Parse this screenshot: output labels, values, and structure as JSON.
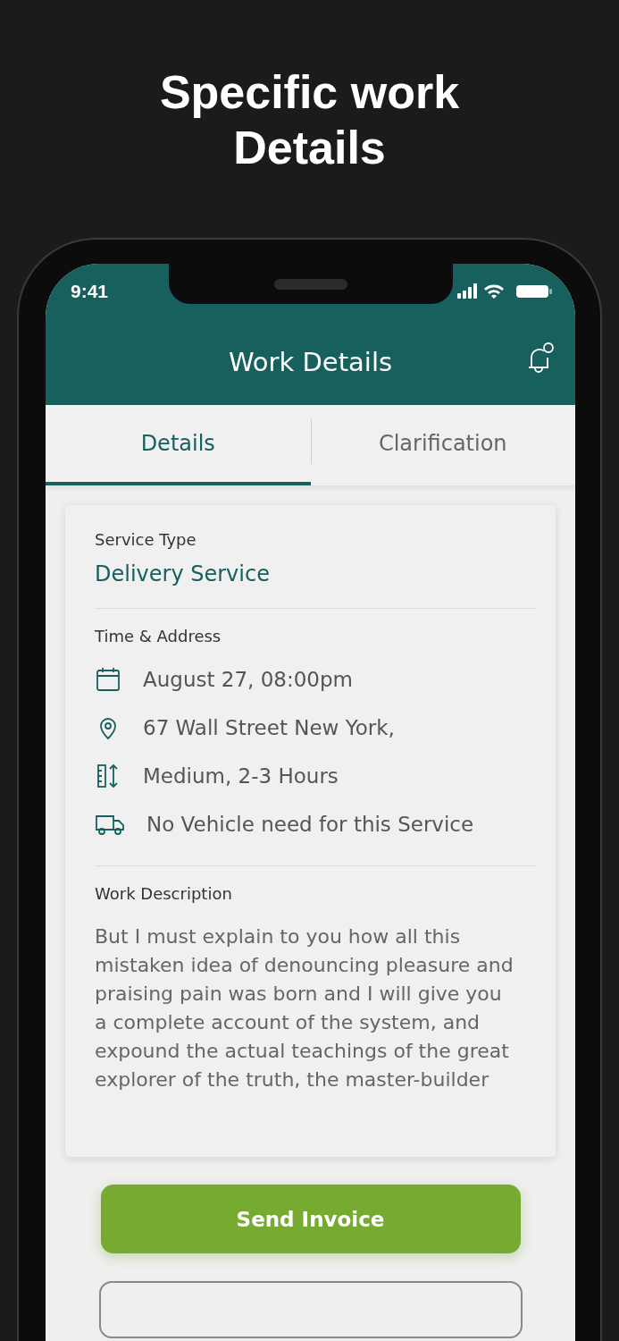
{
  "headline": "Specific work Details",
  "status_bar": {
    "time": "9:41"
  },
  "header": {
    "title": "Work Details"
  },
  "tabs": [
    {
      "label": "Details",
      "selected": true
    },
    {
      "label": "Clarification",
      "selected": false
    }
  ],
  "service": {
    "label": "Service Type",
    "value": "Delivery Service"
  },
  "time_address": {
    "label": "Time & Address",
    "items": [
      {
        "kind": "date",
        "text": "August 27,  08:00pm"
      },
      {
        "kind": "location",
        "text": "67 Wall Street New York,"
      },
      {
        "kind": "size",
        "text": "Medium, 2-3 Hours"
      },
      {
        "kind": "vehicle",
        "text": "No Vehicle need for this Service"
      }
    ]
  },
  "description": {
    "label": "Work Description",
    "text": "But I must explain to you how all this mistaken idea of denouncing pleasure and praising pain was born and I will give you a complete account of the system, and expound the actual teachings of the great explorer of the truth, the master-builder"
  },
  "primary_button": "Send Invoice"
}
